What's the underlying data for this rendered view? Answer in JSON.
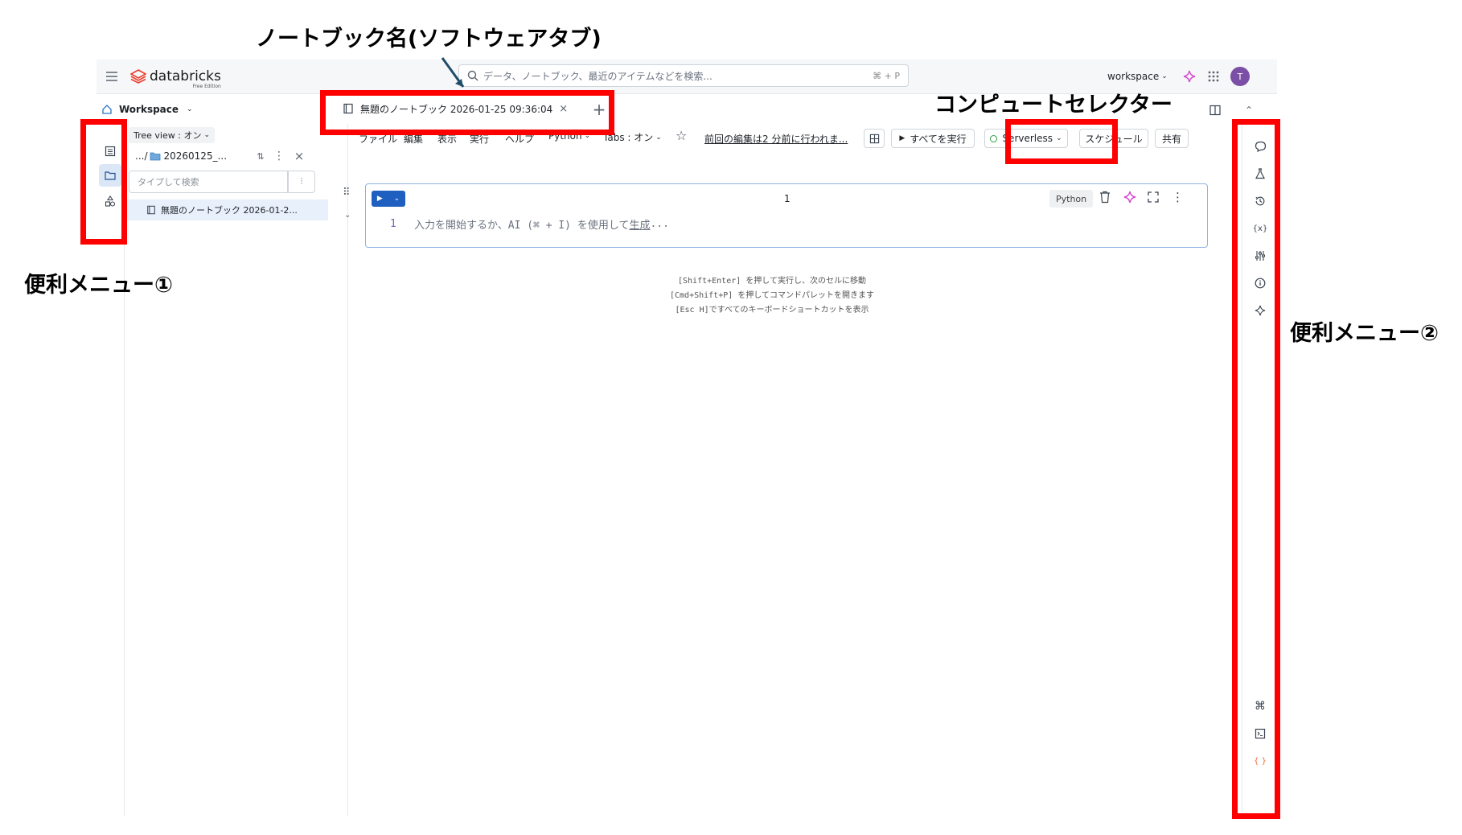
{
  "annotations": {
    "notebook_name": "ノートブック名(ソフトウェアタブ)",
    "compute_selector": "コンピュートセレクター",
    "menu1": "便利メニュー①",
    "menu2": "便利メニュー②"
  },
  "topbar": {
    "logo_text": "databricks",
    "logo_sub": "Free Edition",
    "search_placeholder": "データ、ノートブック、最近のアイテムなどを検索...",
    "search_shortcut": "⌘ + P",
    "workspace_label": "workspace",
    "avatar_letter": "T",
    "avatar_color": "#7b4fa6"
  },
  "breadcrumb": {
    "workspace": "Workspace"
  },
  "tab": {
    "title": "無題のノートブック 2026-01-25 09:36:04"
  },
  "sidebar": {
    "tree_view": "Tree view : オン",
    "path_prefix": ".../",
    "folder_name": "20260125_...",
    "search_placeholder": "タイプして検索",
    "file_name": "無題のノートブック 2026-01-2..."
  },
  "menubar": {
    "items": [
      "ファイル",
      "編集",
      "表示",
      "実行",
      "ヘルプ"
    ],
    "language": "Python",
    "tabs": "Tabs : オン",
    "last_edit": "前回の編集は2 分前に行われま...",
    "run_all": "すべてを実行",
    "compute": "Serverless",
    "schedule": "スケジュール",
    "share": "共有"
  },
  "cell": {
    "number": "1",
    "language": "Python",
    "line_number": "1",
    "placeholder_text": "入力を開始するか、AI (⌘ + I) を使用して",
    "placeholder_link": "生成",
    "placeholder_end": "..."
  },
  "hints": [
    "[Shift+Enter] を押して実行し、次のセルに移動",
    "[Cmd+Shift+P] を押してコマンドパレットを開きます",
    "[Esc H]ですべてのキーボードショートカットを表示"
  ],
  "colors": {
    "accent_red": "#ff0000",
    "run_blue": "#1f5fbf",
    "ai_pink": "#d44bd0"
  }
}
